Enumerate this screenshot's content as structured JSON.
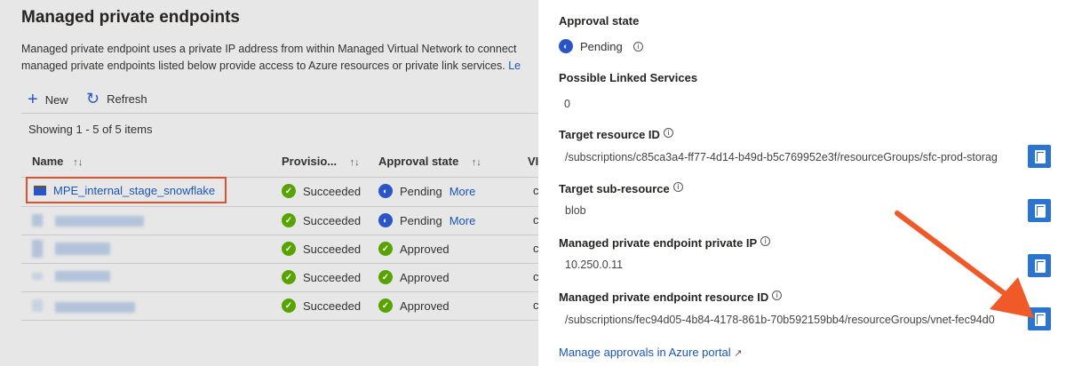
{
  "left": {
    "title": "Managed private endpoints",
    "description_line1": "Managed private endpoint uses a private IP address from within Managed Virtual Network to connect",
    "description_line2": "managed private endpoints listed below provide access to Azure resources or private link services.",
    "learn_more": "Le",
    "toolbar": {
      "new_label": "New",
      "refresh_label": "Refresh"
    },
    "showing": "Showing 1 - 5 of 5 items",
    "columns": [
      "Name",
      "Provisio...",
      "Approval state",
      "VI"
    ],
    "rows": [
      {
        "name": "MPE_internal_stage_snowflake",
        "provisioning": "Succeeded",
        "approval": "Pending",
        "more": "More",
        "extra": "c"
      },
      {
        "provisioning": "Succeeded",
        "approval": "Pending",
        "more": "More",
        "extra": "c"
      },
      {
        "provisioning": "Succeeded",
        "approval": "Approved",
        "extra": "c"
      },
      {
        "provisioning": "Succeeded",
        "approval": "Approved",
        "extra": "c"
      },
      {
        "provisioning": "Succeeded",
        "approval": "Approved",
        "extra": "c"
      }
    ]
  },
  "details": {
    "approval_state_label": "Approval state",
    "approval_state_value": "Pending",
    "linked_services_label": "Possible Linked Services",
    "linked_services_value": "0",
    "target_resource_label": "Target resource ID",
    "target_resource_value": "/subscriptions/c85ca3a4-ff77-4d14-b49d-b5c769952e3f/resourceGroups/sfc-prod-storag",
    "target_sub_label": "Target sub-resource",
    "target_sub_value": "blob",
    "private_ip_label": "Managed private endpoint private IP",
    "private_ip_value": "10.250.0.11",
    "resource_id_label": "Managed private endpoint resource ID",
    "resource_id_value": "/subscriptions/fec94d05-4b84-4178-861b-70b592159bb4/resourceGroups/vnet-fec94d0",
    "manage_link": "Manage approvals in Azure portal"
  },
  "colors": {
    "highlight": "#e0502a",
    "arrow": "#f05a28",
    "accent": "#2b75d1"
  }
}
